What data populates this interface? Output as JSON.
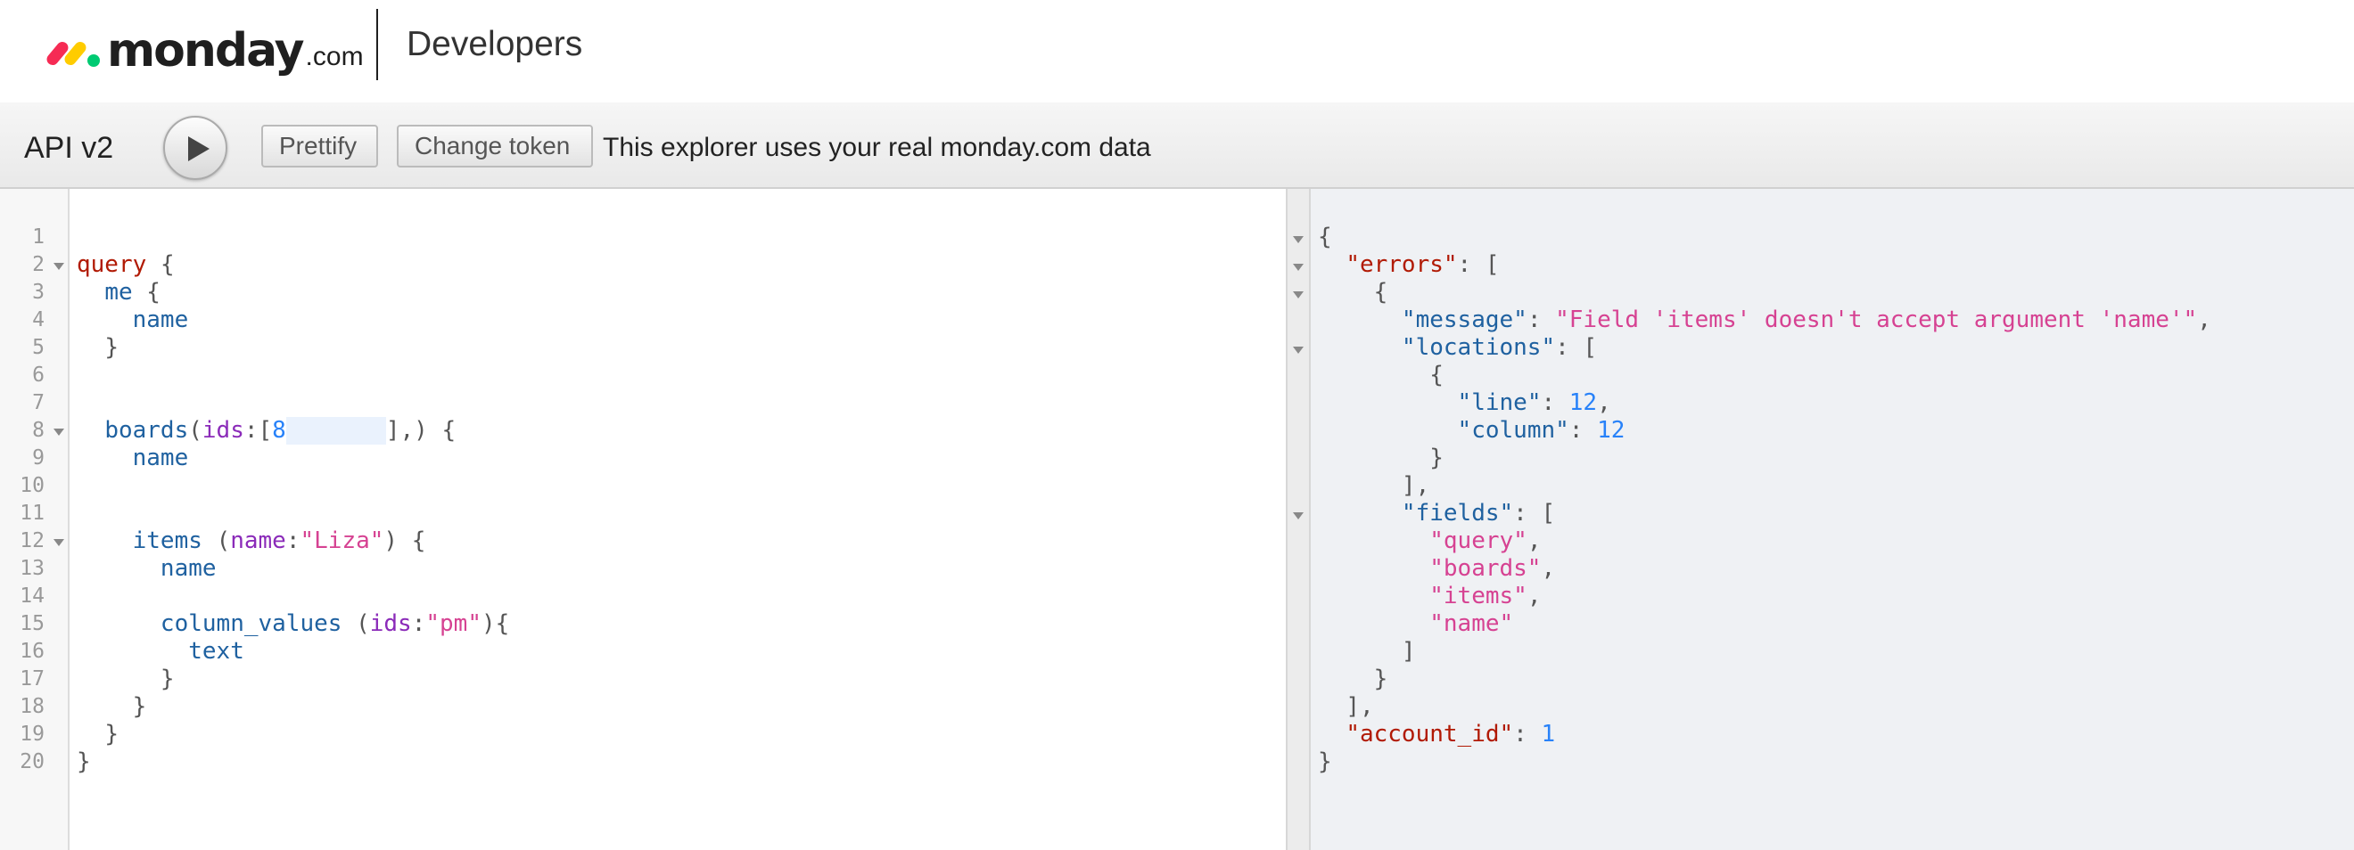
{
  "header": {
    "logo_word": "monday",
    "logo_suffix": ".com",
    "title": "Developers"
  },
  "toolbar": {
    "api_title": "API v2",
    "run_icon": "play-icon",
    "prettify_label": "Prettify",
    "change_token_label": "Change token",
    "note": "This explorer uses your real monday.com data"
  },
  "editor": {
    "line_numbers": [
      "1",
      "2",
      "3",
      "4",
      "5",
      "6",
      "7",
      "8",
      "9",
      "10",
      "11",
      "12",
      "13",
      "14",
      "15",
      "16",
      "17",
      "18",
      "19",
      "20"
    ],
    "query_kw": "query",
    "brace_open": "{",
    "brace_close": "}",
    "me": "me",
    "name": "name",
    "boards": "boards",
    "ids_arg": "ids",
    "board_id_visible": "8",
    "boards_tail": "],) {",
    "items": "items",
    "name_arg": "name",
    "name_value": "\"Liza\"",
    "column_values": "column_values",
    "ids_value": "\"pm\"",
    "text": "text"
  },
  "result": {
    "errors_key": "\"errors\"",
    "message_key": "\"message\"",
    "message_value": "\"Field 'items' doesn't accept argument 'name'\"",
    "locations_key": "\"locations\"",
    "line_key": "\"line\"",
    "line_value": "12",
    "column_key": "\"column\"",
    "column_value": "12",
    "fields_key": "\"fields\"",
    "fields": [
      "\"query\"",
      "\"boards\"",
      "\"items\"",
      "\"name\""
    ],
    "account_id_key": "\"account_id\"",
    "account_id_value": "1"
  },
  "colors": {
    "keyword": "#b11a04",
    "field": "#1f61a0",
    "argument": "#8b2bb9",
    "number": "#2882f9",
    "string": "#d64292"
  }
}
